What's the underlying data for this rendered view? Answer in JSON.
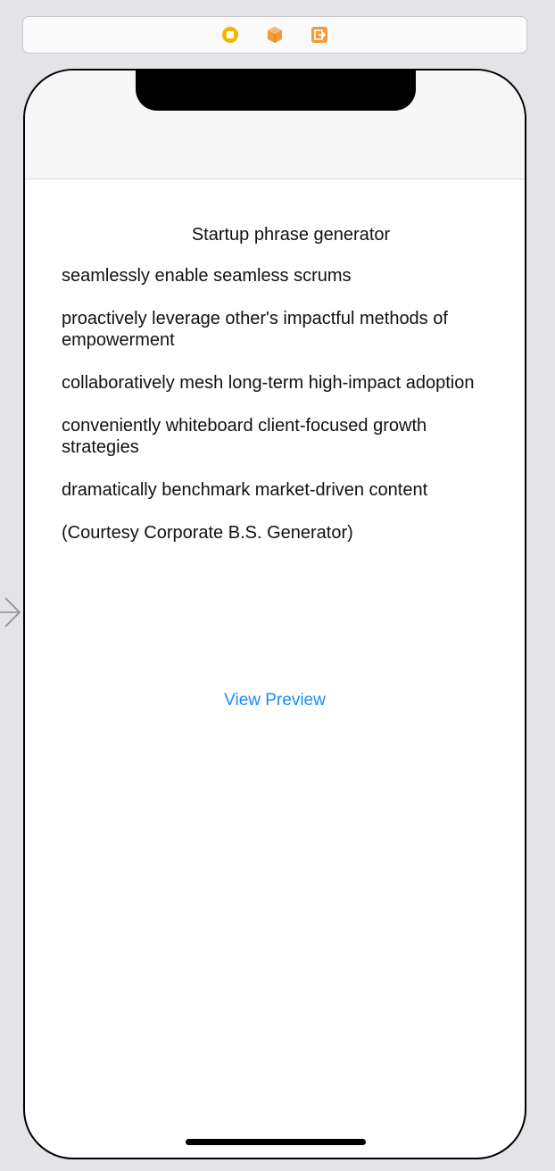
{
  "window": {
    "dock_icons": [
      "view-controller-icon",
      "first-responder-icon",
      "exit-icon"
    ]
  },
  "screen": {
    "title": "Startup phrase generator",
    "phrases": [
      {
        "text": "seamlessly enable seamless scrums"
      },
      {
        "text": "proactively leverage other's impactful methods of empowerment"
      },
      {
        "text": "collaboratively mesh long-term high-impact adoption"
      },
      {
        "text": "conveniently whiteboard client-focused growth strategies"
      },
      {
        "text": "dramatically benchmark market-driven content"
      }
    ],
    "courtesy": "(Courtesy Corporate B.S. Generator)",
    "preview_link": "View Preview"
  },
  "colors": {
    "link": "#1a8cff",
    "canvas_background": "#e4e4e8",
    "dock_yellow": "#f4b400",
    "dock_orange": "#f29b38"
  }
}
